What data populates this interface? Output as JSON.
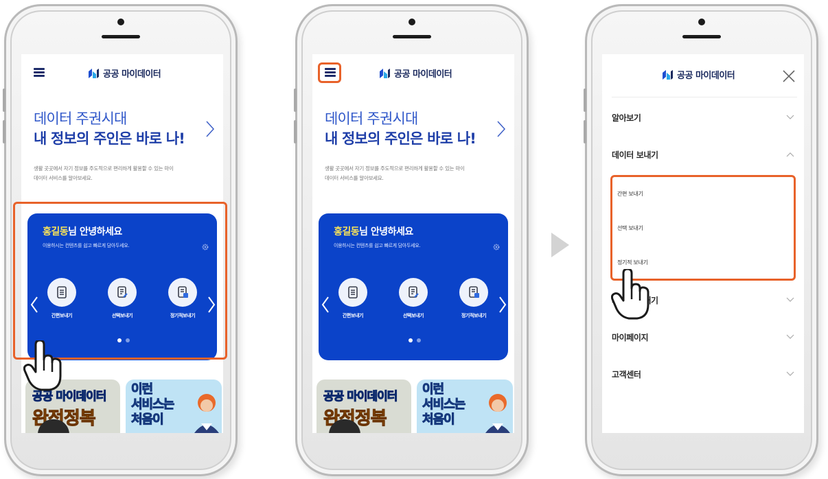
{
  "app": {
    "logo_text": "공공 마이데이터",
    "brand_color": "#0b43c9",
    "accent_color": "#e8622a"
  },
  "home": {
    "hero_line1": "데이터 주권시대",
    "hero_line2": "내 정보의 주인은 바로 나!",
    "hero_desc_line1": "생활 곳곳에서 자기 정보를 주도적으로 편리하게 활용할 수 있는 마이",
    "hero_desc_line2": "데이터 서비스를 알아보세요.",
    "card_greet_name": "홍길동",
    "card_greet_rest": "님 안녕하세요",
    "card_sub": "이용하시는 컨텐츠를 쉽고 빠르게 담아두세요.",
    "services": [
      {
        "label": "간편보내기",
        "icon": "document-icon"
      },
      {
        "label": "선택보내기",
        "icon": "edit-document-icon"
      },
      {
        "label": "정기적보내기",
        "icon": "calendar-document-icon"
      }
    ],
    "carousel_page": 1,
    "carousel_pages": 2,
    "thumb_a_line1": "공공 마이데이터",
    "thumb_a_line2": "완전정복",
    "thumb_b_line1": "이런",
    "thumb_b_line2": "서비스는",
    "thumb_b_line3": "처음이"
  },
  "menu": {
    "items": [
      {
        "label": "알아보기",
        "state": "collapsed"
      },
      {
        "label": "데이터 보내기",
        "state": "expanded"
      },
      {
        "label": "서비스 보내기",
        "state": "collapsed"
      },
      {
        "label": "마이페이지",
        "state": "collapsed"
      },
      {
        "label": "고객센터",
        "state": "collapsed"
      }
    ],
    "sub_items": [
      "간편 보내기",
      "선택 보내기",
      "정기적 보내기"
    ]
  }
}
